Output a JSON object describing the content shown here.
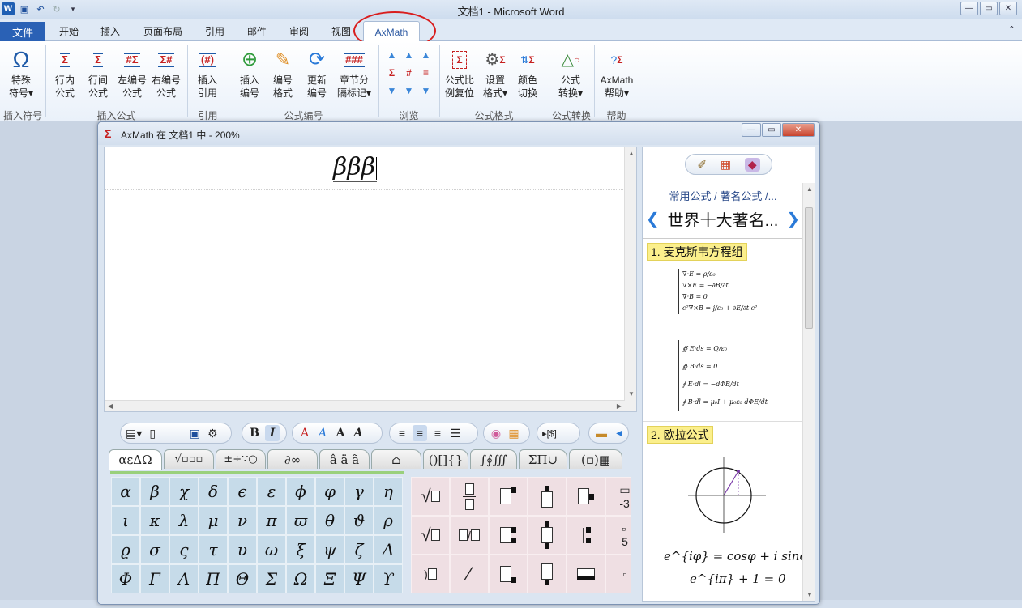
{
  "window": {
    "title": "文档1 - Microsoft Word"
  },
  "ribbon_tabs": {
    "file": "文件",
    "home": "开始",
    "insert": "插入",
    "layout": "页面布局",
    "references": "引用",
    "mailings": "邮件",
    "review": "审阅",
    "view": "视图",
    "axmath": "AxMath"
  },
  "ribbon": {
    "special_symbol": [
      "特殊",
      "符号"
    ],
    "inline_formula": [
      "行内",
      "公式"
    ],
    "line_formula": [
      "行间",
      "公式"
    ],
    "left_numbered": [
      "左编号",
      "公式"
    ],
    "right_numbered": [
      "右编号",
      "公式"
    ],
    "insert_ref": [
      "插入",
      "引用"
    ],
    "insert_number": [
      "插入",
      "编号"
    ],
    "number_format": [
      "编号",
      "格式"
    ],
    "update_number": [
      "更新",
      "编号"
    ],
    "chapter_sep": [
      "章节分",
      "隔标记"
    ],
    "ratio_reset": [
      "公式比",
      "例复位"
    ],
    "set_format": [
      "设置",
      "格式"
    ],
    "color_switch": [
      "颜色",
      "切换"
    ],
    "formula_convert": [
      "公式",
      "转换"
    ],
    "axmath_help": [
      "AxMath",
      "帮助"
    ],
    "groups": {
      "insert_symbol": "插入符号",
      "insert_formula": "插入公式",
      "reference": "引用",
      "formula_number": "公式编号",
      "browse": "浏览",
      "formula_format": "公式格式",
      "formula_convert": "公式转换",
      "help": "帮助"
    }
  },
  "axmath_window": {
    "title": "AxMath 在 文档1 中 - 200%",
    "formula": "βββ"
  },
  "toolbar": {
    "bold": "B",
    "italic": "I"
  },
  "symbol_tabs": [
    "αεΔΩ",
    "√▫▫▫",
    "±÷∵○",
    "∂∞",
    "â ä ã",
    "⌂",
    "()[]{}",
    "∫∮∭",
    "ΣΠ∪",
    "(▫)▦"
  ],
  "greek_letters": [
    "α",
    "β",
    "χ",
    "δ",
    "ϵ",
    "ε",
    "ϕ",
    "φ",
    "γ",
    "η",
    "ι",
    "κ",
    "λ",
    "μ",
    "ν",
    "π",
    "ϖ",
    "θ",
    "ϑ",
    "ρ",
    "ϱ",
    "σ",
    "ς",
    "τ",
    "υ",
    "ω",
    "ξ",
    "ψ",
    "ζ",
    "Δ",
    "Φ",
    "Γ",
    "Λ",
    "Π",
    "Θ",
    "Σ",
    "Ω",
    "Ξ",
    "Ψ",
    "ϒ"
  ],
  "right_panel": {
    "breadcrumb": "常用公式 / 著名公式 /...",
    "title": "世界十大著名...",
    "section1": "1. 麦克斯韦方程组",
    "section2": "2. 欧拉公式",
    "maxwell_diff": [
      "∇·E = ρ/ε₀",
      "∇×E = −∂B/∂t",
      "∇·B = 0",
      "c²∇×B = j/ε₀ + ∂E/∂t c²"
    ],
    "maxwell_int": [
      "∯ E·ds = Q/ε₀",
      "∯ B·ds = 0",
      "∮ E·dl = −dΦB/dt",
      "∮ B·dl = μ₀I + μ₀ε₀ dΦE/dt"
    ],
    "euler1": "e^{iφ} = cosφ + i sinφ",
    "euler2": "e^{iπ} + 1 = 0"
  }
}
